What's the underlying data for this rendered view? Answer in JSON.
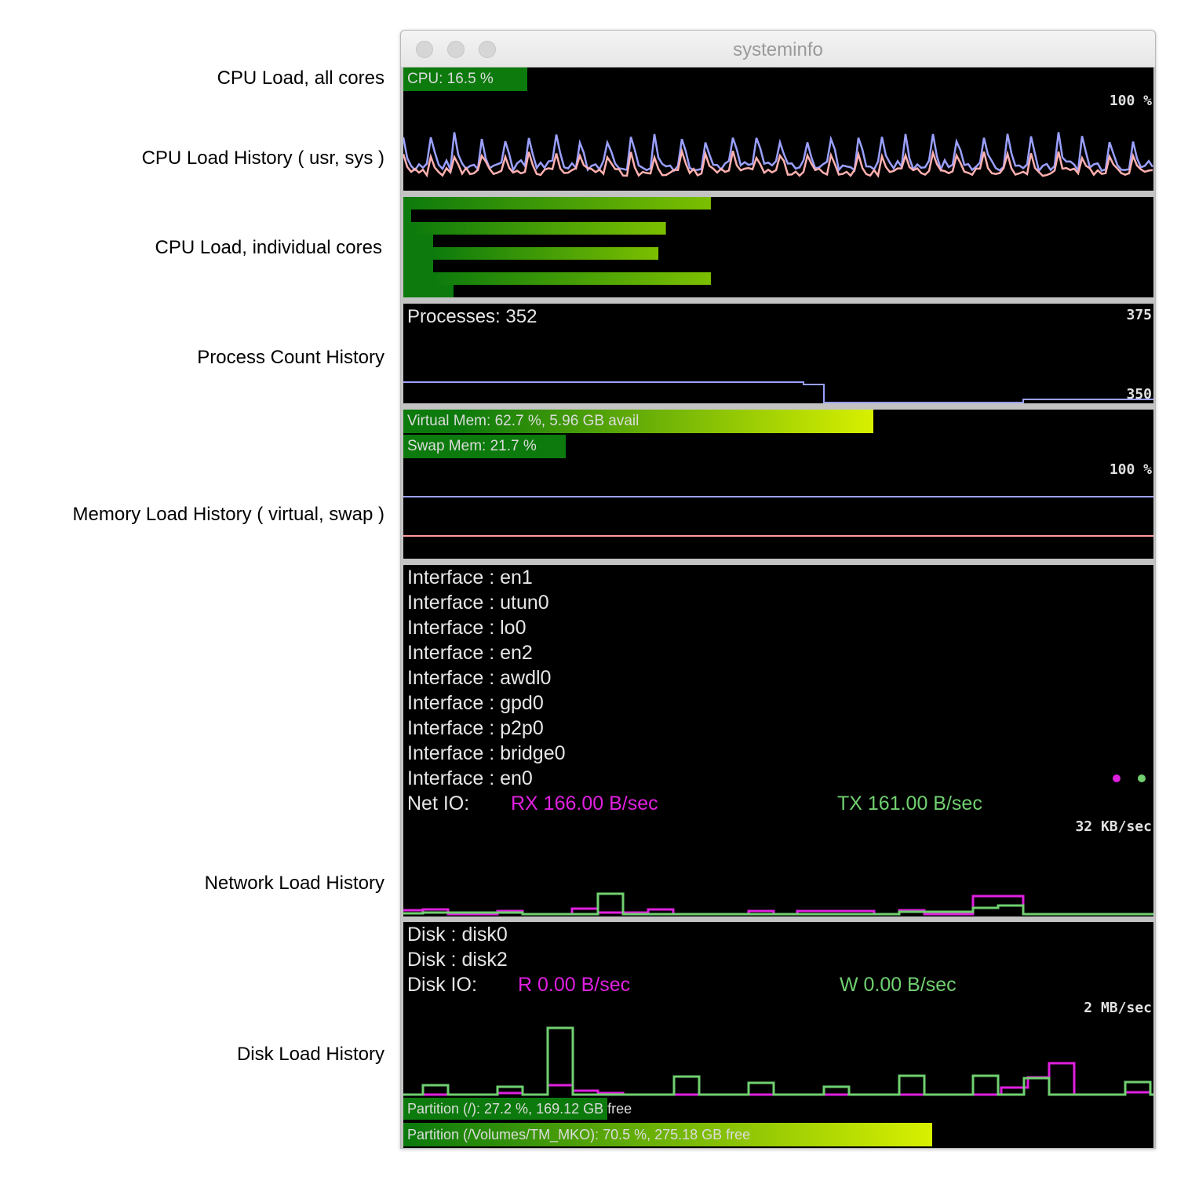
{
  "annotations": {
    "cpu_all": "CPU Load, all cores",
    "cpu_history": "CPU Load History ( usr, sys )",
    "cpu_cores": "CPU Load, individual cores",
    "process_history": "Process Count History",
    "memory_history": "Memory Load History ( virtual, swap )",
    "network_history": "Network Load History",
    "disk_history": "Disk Load History"
  },
  "window": {
    "title": "systeminfo"
  },
  "cpu": {
    "label": "CPU: 16.5 %",
    "load_percent": 16.5,
    "history_scale": "100 %",
    "core_loads_percent": [
      41,
      35,
      34,
      41
    ]
  },
  "processes": {
    "label": "Processes: 352",
    "count": 352,
    "scale_max": "375",
    "scale_min": "350"
  },
  "memory": {
    "virtual_label": "Virtual Mem: 62.7 %, 5.96 GB avail",
    "virtual_percent": 62.7,
    "swap_label": "Swap Mem: 21.7 %",
    "swap_percent": 21.7,
    "history_scale": "100 %"
  },
  "network": {
    "interfaces": [
      "Interface : en1",
      "Interface : utun0",
      "Interface : lo0",
      "Interface : en2",
      "Interface : awdl0",
      "Interface : gpd0",
      "Interface : p2p0",
      "Interface : bridge0",
      "Interface : en0"
    ],
    "io_label": "Net IO:",
    "rx": "RX 166.00 B/sec",
    "tx": "TX 161.00 B/sec",
    "scale": "32 KB/sec",
    "rx_color": "#e020e0",
    "tx_color": "#70d070"
  },
  "disk": {
    "disks": [
      "Disk : disk0",
      "Disk : disk2"
    ],
    "io_label": "Disk IO:",
    "read": "R 0.00 B/sec",
    "write": "W 0.00 B/sec",
    "scale": "2 MB/sec",
    "partitions": [
      {
        "label": "Partition (/): 27.2 %, 169.12 GB free",
        "percent": 27.2
      },
      {
        "label": "Partition (/Volumes/TM_MKO): 70.5 %, 275.18 GB free",
        "percent": 70.5
      }
    ]
  },
  "colors": {
    "panel_bg": "#000000",
    "bar_green": "#0c7a0c",
    "bar_yellow": "#d8f000",
    "usr_line": "#9aa0ff",
    "sys_line": "#ffb0b0"
  }
}
